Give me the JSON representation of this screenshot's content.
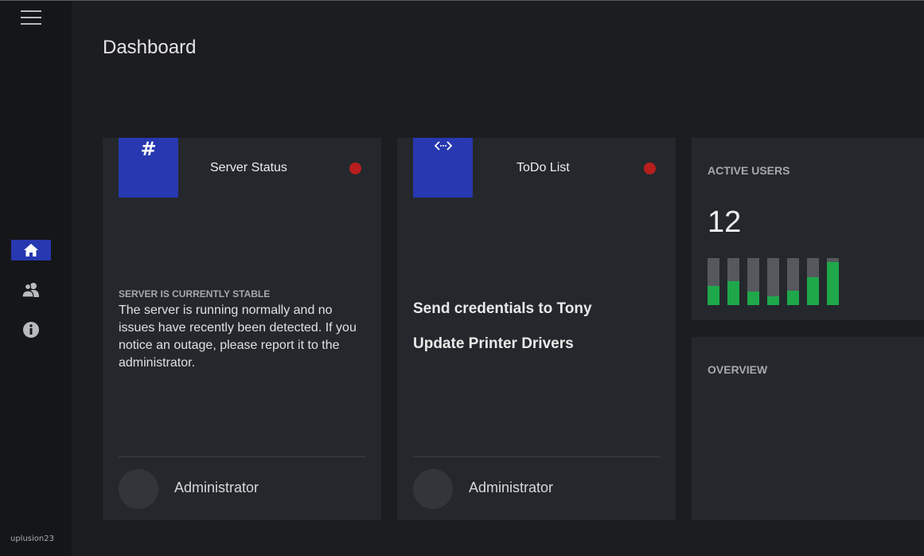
{
  "sidebar": {
    "username": "uplusion23",
    "nav": [
      {
        "icon": "home-icon",
        "active": true
      },
      {
        "icon": "users-icon",
        "active": false
      },
      {
        "icon": "info-icon",
        "active": false
      }
    ]
  },
  "page": {
    "title": "Dashboard"
  },
  "server_card": {
    "icon_glyph": "#",
    "title": "Server Status",
    "status_color": "#b81e1e",
    "status_heading": "SERVER IS CURRENTLY STABLE",
    "status_text": "The server is running normally and no issues have recently been detected. If you notice an outage, please report it to the administrator.",
    "footer_name": "Administrator"
  },
  "todo_card": {
    "icon": "code-icon",
    "title": "ToDo List",
    "status_color": "#b81e1e",
    "items": [
      "Send credentials to Tony",
      "Update Printer Drivers"
    ],
    "footer_name": "Administrator"
  },
  "active_users": {
    "label": "ACTIVE USERS",
    "value": "12",
    "bar_levels": [
      0.41,
      0.51,
      0.29,
      0.19,
      0.3,
      0.59,
      0.92
    ],
    "bar_color": "#1ea84a",
    "track_color": "#55595e"
  },
  "overview": {
    "label": "OVERVIEW"
  },
  "colors": {
    "accent": "#2838b0",
    "status_red": "#b81e1e",
    "card_bg": "#24282c",
    "page_bg": "#1c1d20"
  }
}
